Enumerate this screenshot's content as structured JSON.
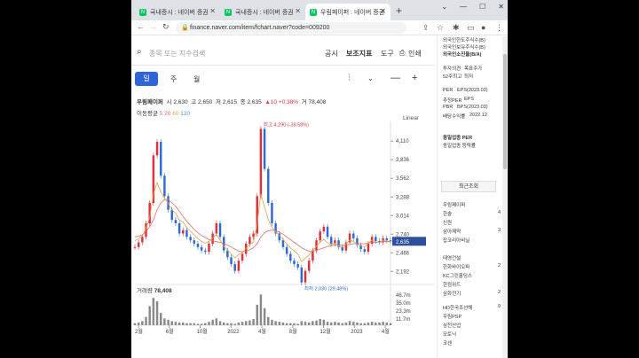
{
  "browser": {
    "tabs": [
      {
        "title": "국내증시 : 네이버 증권"
      },
      {
        "title": "국내증시 : 네이버 증권"
      },
      {
        "title": "우림페이퍼 : 네이버 증권"
      }
    ],
    "url": "finance.naver.com/item/fchart.naver?code=009200"
  },
  "header": {
    "search_placeholder": "종목 또는 지수검색",
    "links": [
      "공시",
      "보조지표",
      "도구",
      "인쇄"
    ]
  },
  "period": {
    "active": "일",
    "others": [
      "주",
      "월"
    ]
  },
  "stock": {
    "name": "우림페이퍼",
    "open_label": "시",
    "open": "2,630",
    "high_label": "고",
    "high": "2,650",
    "low_label": "저",
    "low": "2,615",
    "close_label": "종",
    "close": "2,635",
    "change": "▲10 +0.38%",
    "volume_label": "거",
    "volume": "78,408"
  },
  "ma": {
    "label": "이동평균",
    "periods": [
      "5",
      "20",
      "60",
      "120"
    ],
    "colors": [
      "#9a7bd6",
      "#e36a6a",
      "#e0a545",
      "#5b8dd6"
    ]
  },
  "scale_label": "Linear",
  "chart_data": {
    "type": "line",
    "description_values": {
      "max": {
        "label": "최고 4,290 (-38.58%)",
        "value": 4290
      },
      "min": {
        "label": "최저 2,030 (29.48%)",
        "value": 2030
      },
      "current": {
        "label": "2,635",
        "value": 2635
      }
    },
    "y_ticks": [
      "4,110",
      "3,836",
      "3,562",
      "3,288",
      "3,014",
      "2,740",
      "2,466",
      "2,192"
    ],
    "y_tick_values": [
      4110,
      3836,
      3562,
      3288,
      3014,
      2740,
      2466,
      2192
    ],
    "x_ticks": [
      "2월",
      "6월",
      "10월",
      "2022",
      "4월",
      "8월",
      "12월",
      "2023",
      "4월"
    ],
    "ylim": [
      2000,
      4400
    ],
    "price": [
      2550,
      2620,
      2700,
      2900,
      3200,
      3900,
      4100,
      3600,
      3300,
      3100,
      2950,
      2900,
      2750,
      2800,
      2700,
      2650,
      2600,
      2550,
      2500,
      2480,
      2600,
      2750,
      2900,
      2700,
      2500,
      2400,
      2300,
      2200,
      2350,
      2450,
      2600,
      2700,
      2750,
      3300,
      4290,
      3700,
      3200,
      2900,
      2750,
      2650,
      2550,
      2450,
      2350,
      2300,
      2250,
      2030,
      2200,
      2350,
      2500,
      2650,
      2780,
      2850,
      2700,
      2600,
      2650,
      2550,
      2500,
      2620,
      2750,
      2680,
      2580,
      2520,
      2480,
      2600,
      2700,
      2640,
      2620,
      2680,
      2650,
      2635
    ],
    "ma_slow": [
      2700,
      2710,
      2730,
      2780,
      2850,
      2950,
      3100,
      3200,
      3250,
      3250,
      3200,
      3150,
      3080,
      3000,
      2930,
      2870,
      2810,
      2760,
      2720,
      2690,
      2660,
      2640,
      2630,
      2620,
      2600,
      2580,
      2550,
      2520,
      2490,
      2480,
      2490,
      2510,
      2540,
      2600,
      2700,
      2760,
      2790,
      2800,
      2790,
      2770,
      2740,
      2700,
      2660,
      2620,
      2580,
      2540,
      2510,
      2490,
      2490,
      2500,
      2520,
      2540,
      2560,
      2570,
      2580,
      2580,
      2580,
      2580,
      2590,
      2600,
      2600,
      2600,
      2600,
      2610,
      2620,
      2620,
      2620,
      2630,
      2630,
      2630
    ],
    "volume_ticks": [
      "46.7m",
      "35.0m",
      "23.3m",
      "11.7m"
    ],
    "volume": [
      3,
      4,
      6,
      12,
      28,
      40,
      35,
      18,
      10,
      8,
      6,
      5,
      4,
      4,
      3,
      3,
      3,
      2,
      2,
      3,
      5,
      8,
      10,
      6,
      4,
      3,
      3,
      2,
      4,
      5,
      6,
      7,
      9,
      30,
      45,
      25,
      12,
      8,
      6,
      5,
      4,
      3,
      3,
      3,
      2,
      6,
      5,
      4,
      6,
      7,
      9,
      8,
      5,
      4,
      5,
      4,
      3,
      4,
      6,
      5,
      4,
      3,
      3,
      4,
      5,
      4,
      4,
      5,
      4,
      3
    ]
  },
  "volume_info": {
    "label": "거래량",
    "value": "78,408"
  },
  "right_panel": {
    "top_items": [
      "외국인한도주식수(B)",
      "외국인보유주식수(B)",
      "외국인소진율(B/A)"
    ],
    "invest_items": [
      "투자의견",
      "목표주가",
      "52주최고",
      "최저"
    ],
    "per_items": [
      "PER",
      "EPS(2023.03)",
      "추정PER",
      "EPS",
      "PBR",
      "BPS(2023.03)",
      "배당수익률",
      "2022.12"
    ],
    "industry_items": [
      "동일업종 PER",
      "동일업종 등락률"
    ],
    "recent_label": "최근조회",
    "recent": [
      {
        "name": "우림페이퍼",
        "n": ""
      },
      {
        "name": "한솔",
        "n": "4"
      },
      {
        "name": "신원",
        "n": ""
      },
      {
        "name": "삼아제약",
        "n": "3"
      },
      {
        "name": "잡코리아비닐",
        "n": ""
      },
      {
        "name": "태영건설",
        "n": ""
      },
      {
        "name": "한화바이오파",
        "n": "2"
      },
      {
        "name": "KC그린홀딩스",
        "n": ""
      },
      {
        "name": "한컴위드",
        "n": ""
      },
      {
        "name": "삼화전기",
        "n": "2"
      },
      {
        "name": "HD한국조선해",
        "n": "9"
      },
      {
        "name": "우림PSP",
        "n": ""
      },
      {
        "name": "삼천산업",
        "n": ""
      },
      {
        "name": "모토닉",
        "n": ""
      },
      {
        "name": "코센",
        "n": ""
      }
    ]
  }
}
